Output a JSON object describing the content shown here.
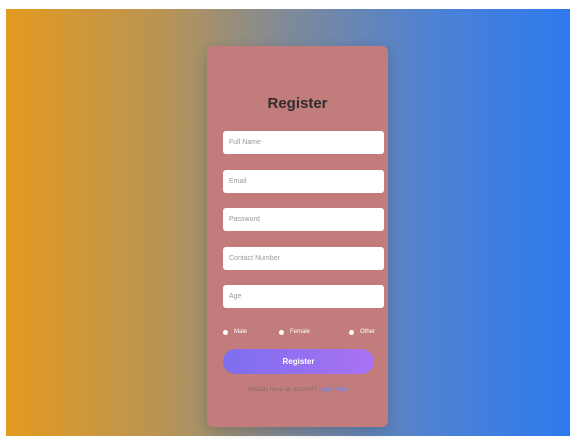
{
  "form": {
    "title": "Register",
    "fields": [
      {
        "placeholder": "Full Name"
      },
      {
        "placeholder": "Email"
      },
      {
        "placeholder": "Password"
      },
      {
        "placeholder": "Contact Number"
      },
      {
        "placeholder": "Age"
      }
    ],
    "gender_options": [
      "Male",
      "Female",
      "Other"
    ],
    "submit_label": "Register",
    "footer_text": "Already have an account?",
    "login_link": "Login here"
  },
  "colors": {
    "gradient_left": "#e49a1f",
    "gradient_right": "#2d7aee",
    "card_bg": "#c17c7b",
    "button_start": "#7d6ef0",
    "button_end": "#aa72f3",
    "link": "#5b8cff"
  }
}
